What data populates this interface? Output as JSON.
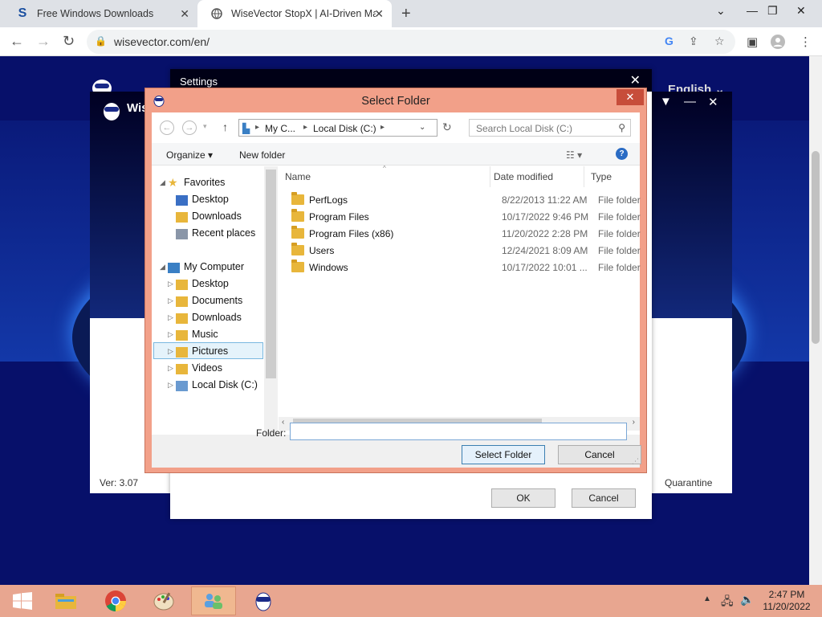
{
  "browser": {
    "tabs": [
      {
        "title": "Free Windows Downloads",
        "favicon": "S"
      },
      {
        "title": "WiseVector StopX | AI-Driven Ma"
      }
    ],
    "url": "wisevector.com/en/"
  },
  "page": {
    "language": "English"
  },
  "app": {
    "brand": "Wis",
    "version": "Ver: 3.07",
    "quarantine": "Quarantine"
  },
  "settings": {
    "title": "Settings",
    "ok": "OK",
    "cancel": "Cancel"
  },
  "dialog": {
    "title": "Select Folder",
    "path": [
      "My C...",
      "Local Disk (C:)"
    ],
    "search_placeholder": "Search Local Disk (C:)",
    "organize": "Organize",
    "new_folder": "New folder",
    "nav": {
      "favorites": "Favorites",
      "fav_items": [
        "Desktop",
        "Downloads",
        "Recent places"
      ],
      "computer": "My Computer",
      "computer_items": [
        "Desktop",
        "Documents",
        "Downloads",
        "Music",
        "Pictures",
        "Videos",
        "Local Disk (C:)"
      ]
    },
    "columns": {
      "name": "Name",
      "date": "Date modified",
      "type": "Type"
    },
    "rows": [
      {
        "name": "PerfLogs",
        "date": "8/22/2013 11:22 AM",
        "type": "File folder"
      },
      {
        "name": "Program Files",
        "date": "10/17/2022 9:46 PM",
        "type": "File folder"
      },
      {
        "name": "Program Files (x86)",
        "date": "11/20/2022 2:28 PM",
        "type": "File folder"
      },
      {
        "name": "Users",
        "date": "12/24/2021 8:09 AM",
        "type": "File folder"
      },
      {
        "name": "Windows",
        "date": "10/17/2022 10:01 ...",
        "type": "File folder"
      }
    ],
    "folder_label": "Folder:",
    "folder_value": "",
    "select_button": "Select Folder",
    "cancel_button": "Cancel"
  },
  "taskbar": {
    "time": "2:47 PM",
    "date": "11/20/2022"
  },
  "colors": {
    "dialog_frame": "#f2a089",
    "close_button": "#c74d3a",
    "taskbar": "#e8a690",
    "page_bg": "#07106a"
  }
}
